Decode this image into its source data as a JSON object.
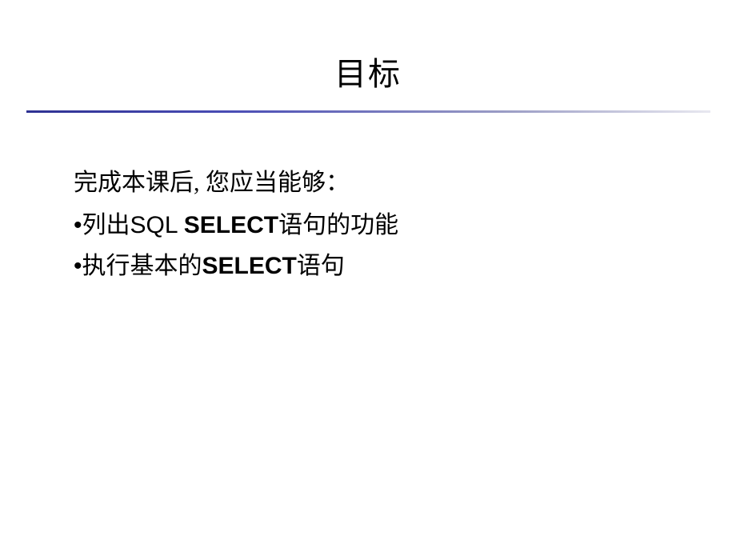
{
  "slide": {
    "title": "目标",
    "intro": "完成本课后, 您应当能够：",
    "bullets": [
      {
        "prefix": "•",
        "part1": "列出",
        "sql": "SQL ",
        "bold": "SELECT",
        "part2": "语句的功能"
      },
      {
        "prefix": "•",
        "part1": "执行基本的",
        "sql": "",
        "bold": "SELECT",
        "part2": "语句"
      }
    ]
  }
}
